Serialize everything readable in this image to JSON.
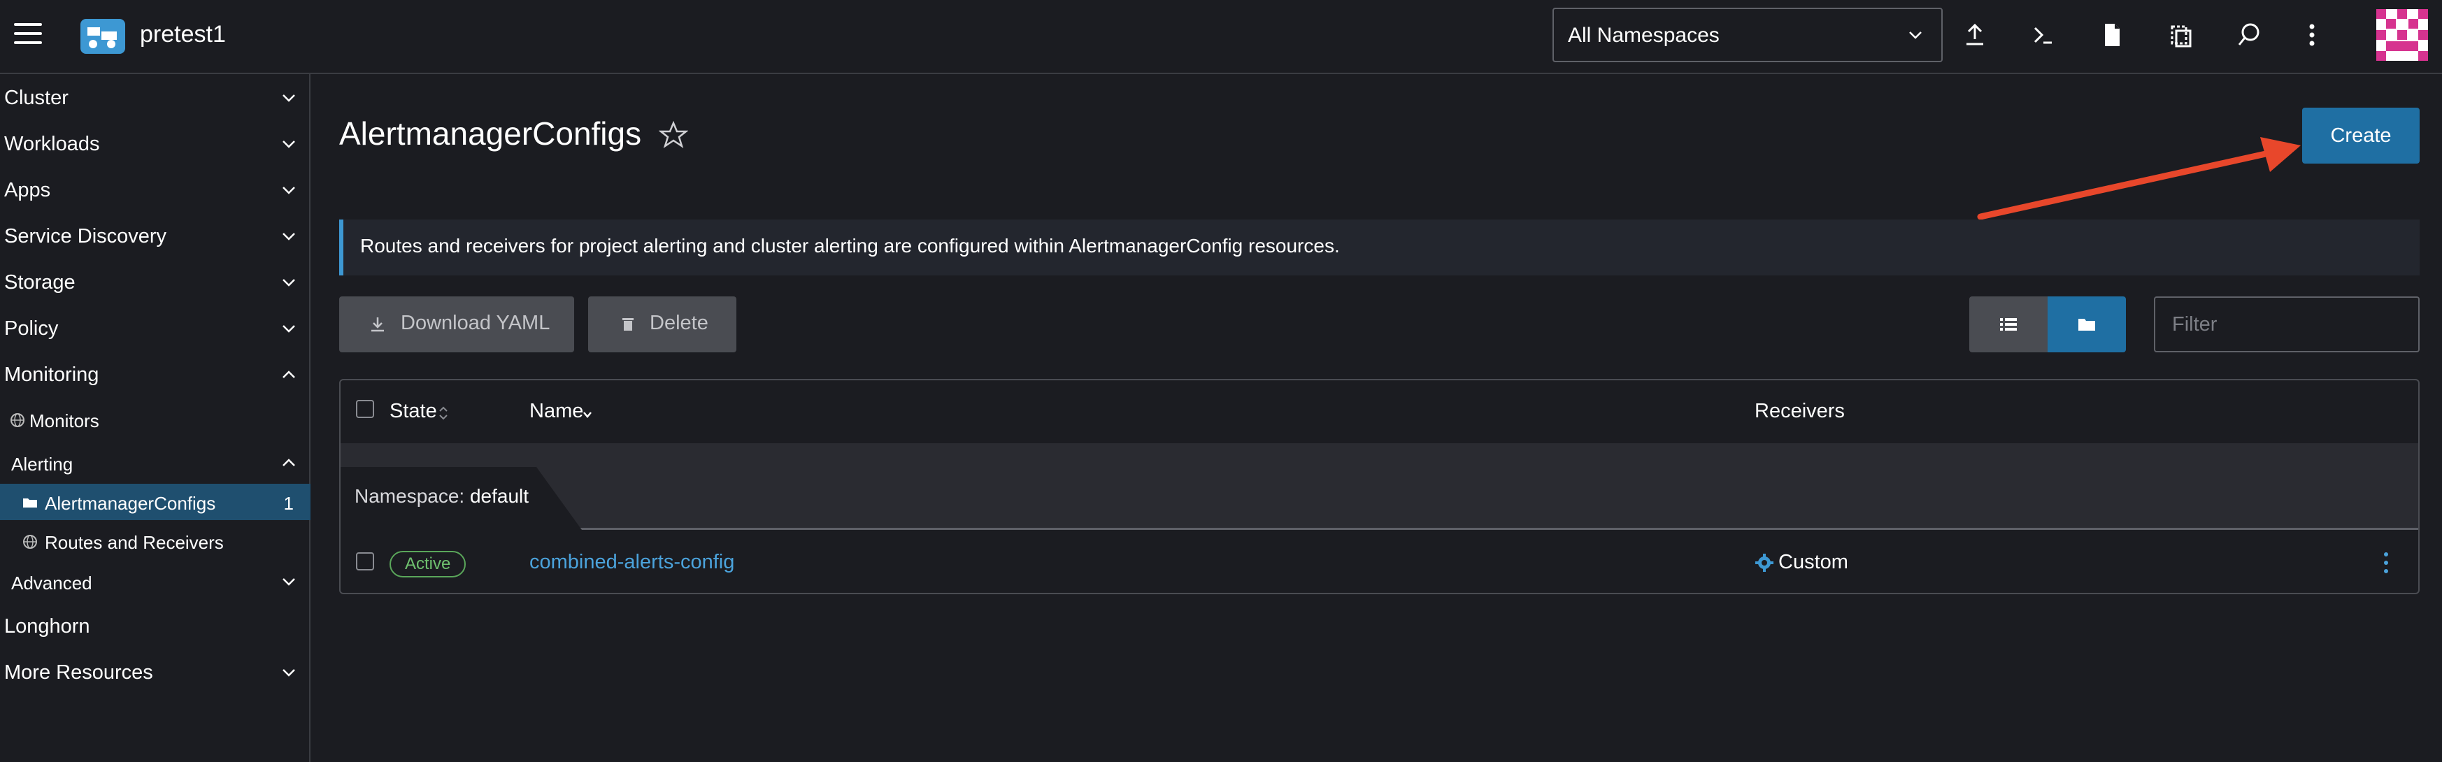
{
  "header": {
    "cluster_name": "pretest1",
    "namespace_select": "All Namespaces",
    "icons": [
      "upload-icon",
      "terminal-icon",
      "file-icon",
      "copy-icon",
      "search-icon",
      "more-vertical-icon"
    ]
  },
  "sidebar": {
    "groups": [
      {
        "label": "Cluster"
      },
      {
        "label": "Workloads"
      },
      {
        "label": "Apps"
      },
      {
        "label": "Service Discovery"
      },
      {
        "label": "Storage"
      },
      {
        "label": "Policy"
      },
      {
        "label": "Monitoring"
      }
    ],
    "monitoring_items": {
      "monitors": "Monitors",
      "alerting": "Alerting",
      "alertmanagerconfigs": "AlertmanagerConfigs",
      "alertmanagerconfigs_count": "1",
      "routes_receivers": "Routes and Receivers",
      "advanced": "Advanced"
    },
    "longhorn": "Longhorn",
    "more_resources": "More Resources"
  },
  "main": {
    "title": "AlertmanagerConfigs",
    "create_label": "Create",
    "banner": "Routes and receivers for project alerting and cluster alerting are configured within AlertmanagerConfig resources.",
    "download_yaml": "Download YAML",
    "delete": "Delete",
    "filter_placeholder": "Filter",
    "table": {
      "col_state": "State",
      "col_name": "Name",
      "col_receivers": "Receivers",
      "group_label": "Namespace:",
      "group_value": "default",
      "rows": [
        {
          "state": "Active",
          "name": "combined-alerts-config",
          "receivers": "Custom"
        }
      ]
    }
  },
  "colors": {
    "accent": "#1f6fa3",
    "link": "#4ba3dc",
    "active_badge": "#6fc16f",
    "arrow": "#e8472b",
    "background": "#1b1c21"
  }
}
